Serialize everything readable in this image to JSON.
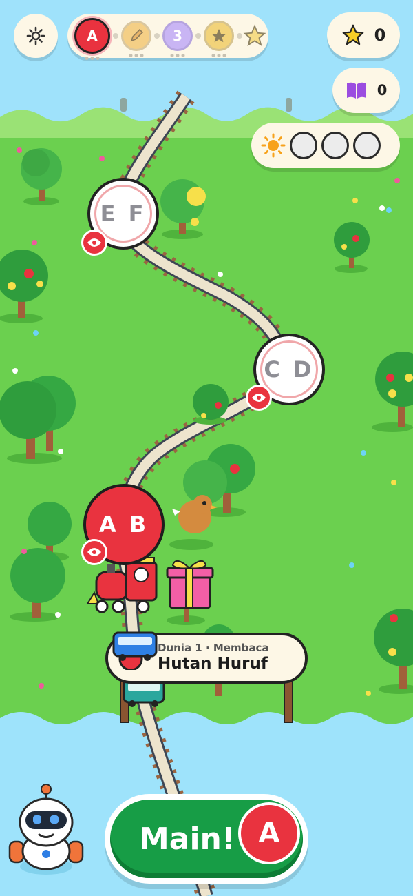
{
  "hud": {
    "settings_icon": "gear-icon",
    "progress": {
      "steps": [
        {
          "id": "letters",
          "label": "A",
          "state": "current"
        },
        {
          "id": "writing",
          "icon": "pencil-icon",
          "state": "locked"
        },
        {
          "id": "count",
          "label": "3",
          "state": "locked"
        },
        {
          "id": "quiz",
          "icon": "star-badge-icon",
          "state": "locked"
        },
        {
          "id": "final",
          "icon": "star-outline-icon",
          "state": "locked"
        }
      ]
    },
    "stars": {
      "count": "0",
      "icon": "star-icon"
    },
    "books": {
      "count": "0",
      "icon": "book-icon"
    },
    "suns": {
      "icon": "sun-icon",
      "earned": 0,
      "total": 3
    }
  },
  "map": {
    "levels": [
      {
        "label": "E F",
        "state": "locked"
      },
      {
        "label": "C D",
        "state": "locked"
      },
      {
        "label": "A B",
        "state": "current"
      }
    ],
    "sign": {
      "subtitle": "Dunia 1 · Membaca",
      "title": "Hutan Huruf"
    }
  },
  "play": {
    "label": "Main!",
    "letter": "A"
  },
  "colors": {
    "accent": "#e9333f",
    "grass": "#69d04f",
    "water": "#9ee3fb",
    "play_green": "#179d46",
    "panel": "#fdf7e6"
  }
}
